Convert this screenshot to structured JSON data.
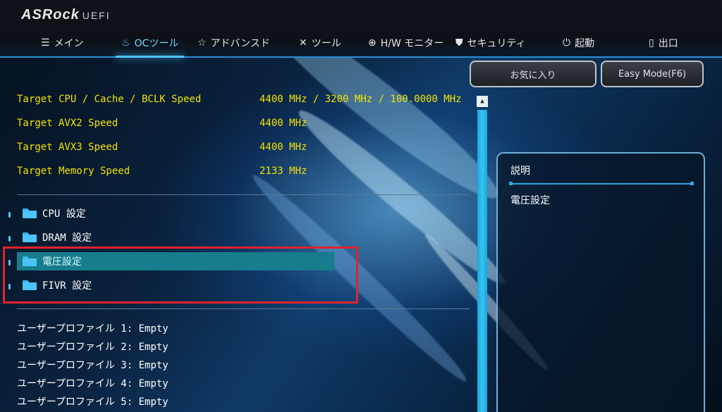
{
  "brand": {
    "name": "ASRock",
    "suffix": "UEFI"
  },
  "nav": [
    {
      "label": "メイン",
      "icon": "list-icon"
    },
    {
      "label": "OCツール",
      "icon": "flame-icon"
    },
    {
      "label": "アドバンスド",
      "icon": "star-icon"
    },
    {
      "label": "ツール",
      "icon": "wrench-icon"
    },
    {
      "label": "H/W モニター",
      "icon": "target-icon"
    },
    {
      "label": "セキュリティ",
      "icon": "shield-icon"
    },
    {
      "label": "起動",
      "icon": "power-icon"
    },
    {
      "label": "出口",
      "icon": "exit-door-icon"
    }
  ],
  "buttons": {
    "favorites": "お気に入り",
    "easy_mode": "Easy Mode(F6)"
  },
  "targets": [
    {
      "label": "Target CPU / Cache / BCLK Speed",
      "value": "4400 MHz / 3200 MHz / 100.0000 MHz"
    },
    {
      "label": "Target AVX2 Speed",
      "value": "4400 MHz"
    },
    {
      "label": "Target AVX3 Speed",
      "value": "4400 MHz"
    },
    {
      "label": "Target Memory Speed",
      "value": "2133 MHz"
    }
  ],
  "menu": [
    {
      "label": "CPU 設定"
    },
    {
      "label": "DRAM 設定"
    },
    {
      "label": "電圧設定"
    },
    {
      "label": "FIVR 設定"
    }
  ],
  "profiles": [
    "ユーザープロファイル 1: Empty",
    "ユーザープロファイル 2: Empty",
    "ユーザープロファイル 3: Empty",
    "ユーザープロファイル 4: Empty",
    "ユーザープロファイル 5: Empty"
  ],
  "description": {
    "title": "説明",
    "text": "電圧設定"
  },
  "colors": {
    "accent": "#4fc3ff",
    "target_text": "#f2e300",
    "selection": "#177c8c",
    "highlight_box": "#e0222c"
  }
}
